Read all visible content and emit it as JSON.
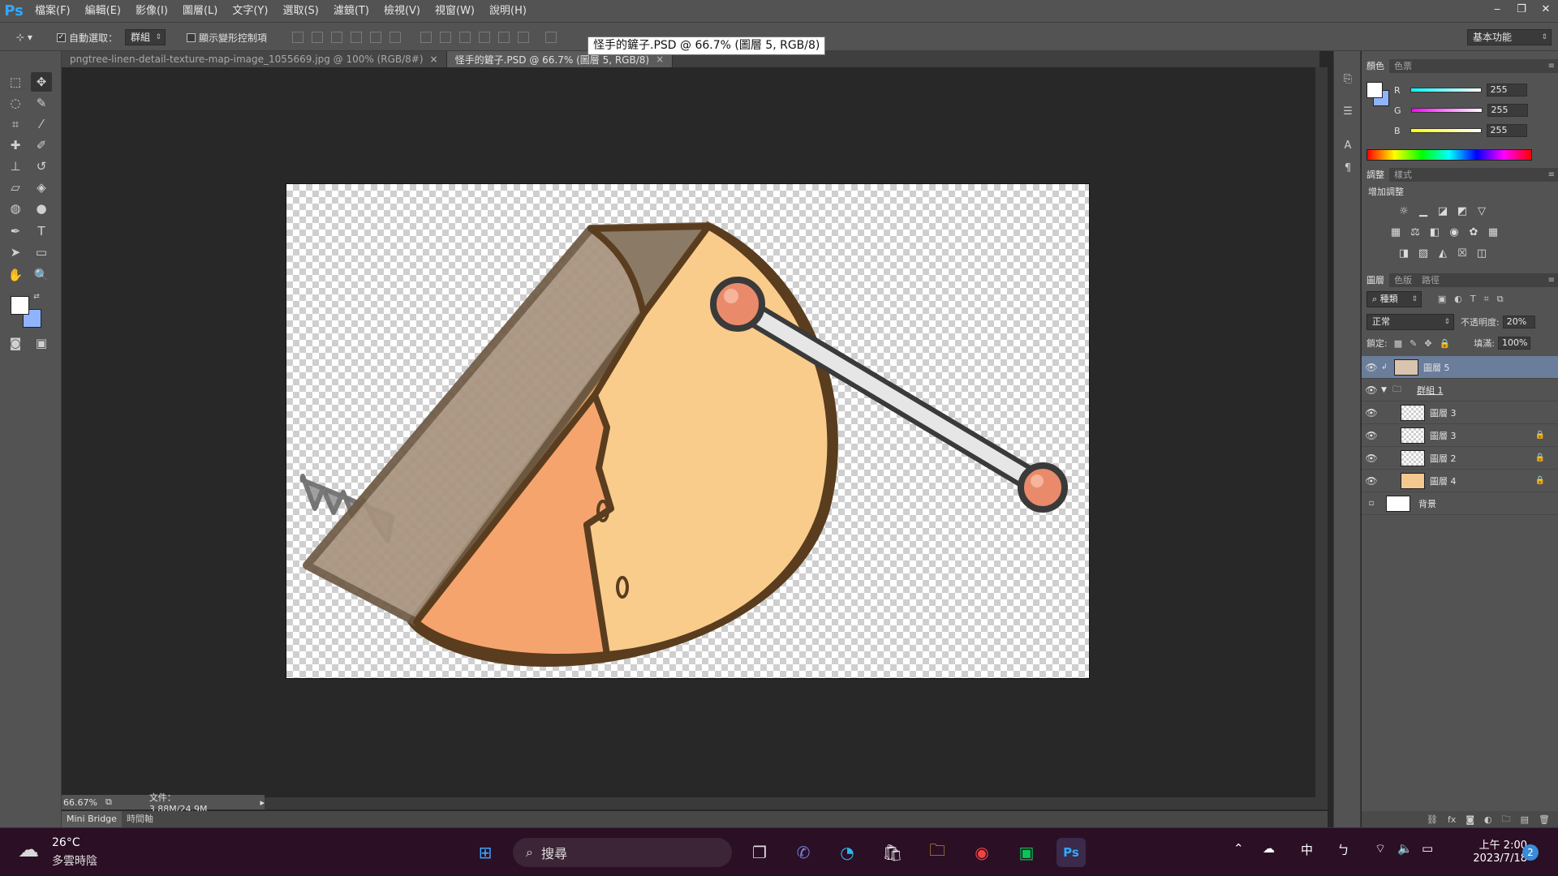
{
  "app": {
    "logo": "Ps"
  },
  "menu": [
    "檔案(F)",
    "編輯(E)",
    "影像(I)",
    "圖層(L)",
    "文字(Y)",
    "選取(S)",
    "濾鏡(T)",
    "檢視(V)",
    "視窗(W)",
    "說明(H)"
  ],
  "window_controls": {
    "minimize": "‒",
    "restore": "❐",
    "close": "✕"
  },
  "options": {
    "auto_select_label": "自動選取：",
    "auto_select_checked": true,
    "auto_select_target": "群組",
    "transform_controls_label": "顯示變形控制項",
    "workspace": "基本功能"
  },
  "tooltip": "怪手的鏟子.PSD @ 66.7% (圖層 5, RGB/8)",
  "tabs": [
    {
      "title": "pngtree-linen-detail-texture-map-image_1055669.jpg @ 100% (RGB/8#)",
      "active": false
    },
    {
      "title": "怪手的鏟子.PSD @ 66.7% (圖層 5, RGB/8)",
      "active": true
    }
  ],
  "status": {
    "zoom": "66.67%",
    "doc_size": "文件：3.88M/24.9M"
  },
  "bottom_tabs": [
    "Mini Bridge",
    "時間軸"
  ],
  "color_panel": {
    "tabs": [
      "顏色",
      "色票"
    ],
    "r": "255",
    "g": "255",
    "b": "255",
    "r_label": "R",
    "g_label": "G",
    "b_label": "B"
  },
  "adjust_panel": {
    "tabs": [
      "調整",
      "樣式"
    ],
    "title": "增加調整"
  },
  "layers_panel": {
    "tabs": [
      "圖層",
      "色版",
      "路徑"
    ],
    "filter_kind": "種類",
    "blend_mode": "正常",
    "opacity_label": "不透明度:",
    "opacity": "20%",
    "lock_label": "鎖定:",
    "fill_label": "填滿:",
    "fill": "100%",
    "layers": [
      {
        "name": "圖層 5",
        "active": true,
        "locked": false
      },
      {
        "name": "群組 1",
        "group": true
      },
      {
        "name": "圖層 3",
        "locked": false
      },
      {
        "name": "圖層 3",
        "locked": true
      },
      {
        "name": "圖層 2",
        "locked": true
      },
      {
        "name": "圖層 4",
        "locked": true
      },
      {
        "name": "背景",
        "background": true
      }
    ]
  },
  "taskbar": {
    "weather_temp": "26°C",
    "weather_desc": "多雲時陰",
    "search": "搜尋",
    "ime": "中",
    "ime2": "ㄅ",
    "time": "上午 2:00",
    "date": "2023/7/18",
    "notifications": "2"
  },
  "colors": {
    "fg": "#ffffff",
    "bg": "#8fb3ff",
    "accent": "#31a8ff",
    "active_layer": "#6a7d9a"
  }
}
